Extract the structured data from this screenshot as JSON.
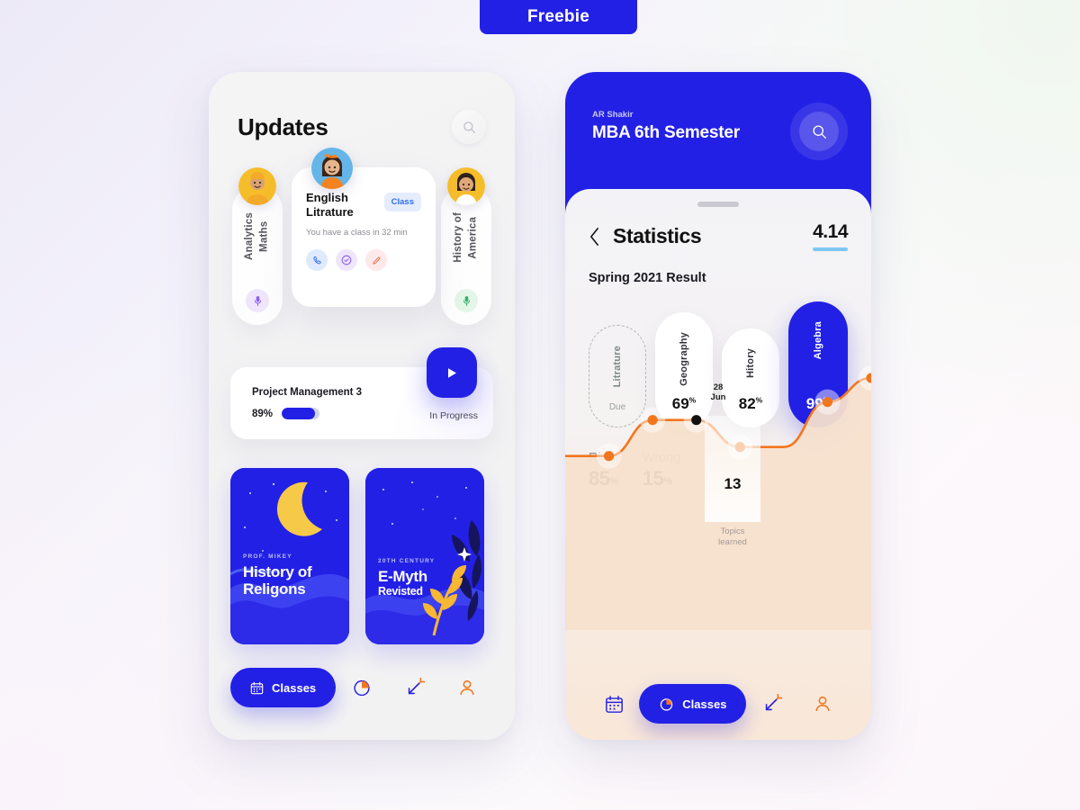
{
  "badge": {
    "label": "Freebie"
  },
  "left_phone": {
    "header": {
      "title": "Updates",
      "search_icon": "search-icon"
    },
    "carousel": {
      "left_card": {
        "title": "Analytics\nMaths",
        "icon": "microphone-icon"
      },
      "right_card": {
        "title": "History of\nAmerica",
        "icon": "microphone-icon"
      },
      "main_card": {
        "title": "English\nLitrature",
        "badge": "Class",
        "subtitle": "You have a class in 32 min",
        "actions": [
          "phone-icon",
          "check-circle-icon",
          "pencil-icon"
        ]
      }
    },
    "progress": {
      "title": "Project Management 3",
      "percent": "89%",
      "percent_value": 89,
      "status": "In Progress",
      "play_icon": "play-icon"
    },
    "books": [
      {
        "kicker": "PROF. MIKEY",
        "title": "History of",
        "title2": "Religons",
        "art": "moon"
      },
      {
        "kicker": "20TH CENTURY",
        "title": "E-Myth",
        "title2": "Revisted",
        "art": "plant"
      }
    ],
    "nav": {
      "active_label": "Classes",
      "active_icon": "calendar-icon",
      "items": [
        "pie-chart-icon",
        "transfer-arrows-icon",
        "person-icon"
      ]
    }
  },
  "right_phone": {
    "header": {
      "user": "AR Shakir",
      "semester": "MBA 6th Semester",
      "search_icon": "search-icon"
    },
    "sheet": {
      "back_icon": "chevron-left-icon",
      "title": "Statistics",
      "gpa": "4.14",
      "section_title": "Spring 2021 Result"
    },
    "subjects": [
      {
        "name": "Litrature",
        "score": "Due",
        "state": "due"
      },
      {
        "name": "Geography",
        "score": "69",
        "unit": "%",
        "state": "normal"
      },
      {
        "name": "Hitory",
        "score": "82",
        "unit": "%",
        "state": "normal"
      },
      {
        "name": "Algebra",
        "score": "99",
        "unit": "%",
        "state": "active"
      }
    ],
    "accuracy": [
      {
        "label": "Right",
        "value": "85",
        "unit": "%"
      },
      {
        "label": "Wrong",
        "value": "15",
        "unit": "%"
      }
    ],
    "tooltip": {
      "date": "28\nJun",
      "value": "13",
      "caption": "Topics\nlearned"
    },
    "nav": {
      "active_label": "Classes",
      "active_icon": "pie-chart-icon",
      "items": [
        "calendar-icon",
        "transfer-arrows-icon",
        "person-icon"
      ]
    }
  },
  "chart_data": {
    "type": "line",
    "title": "",
    "xlabel": "",
    "ylabel": "",
    "annotation": {
      "x_label": "28 Jun",
      "value": 13,
      "caption": "Topics learned"
    },
    "x": [
      0,
      1,
      2,
      3,
      4,
      5,
      6,
      7
    ],
    "values": [
      20,
      20,
      44,
      44,
      26,
      26,
      56,
      72
    ],
    "point_indices": [
      1,
      2,
      3,
      4,
      6,
      7
    ],
    "line_color": "#f2761e",
    "fill_color": "#f7e0cd",
    "grid": false,
    "legend": "none"
  },
  "colors": {
    "brand_blue": "#2320e6",
    "accent_orange": "#f2761e",
    "text_dark": "#111111",
    "text_muted": "#8b8b93",
    "gpa_underline": "#7cc8f5"
  }
}
